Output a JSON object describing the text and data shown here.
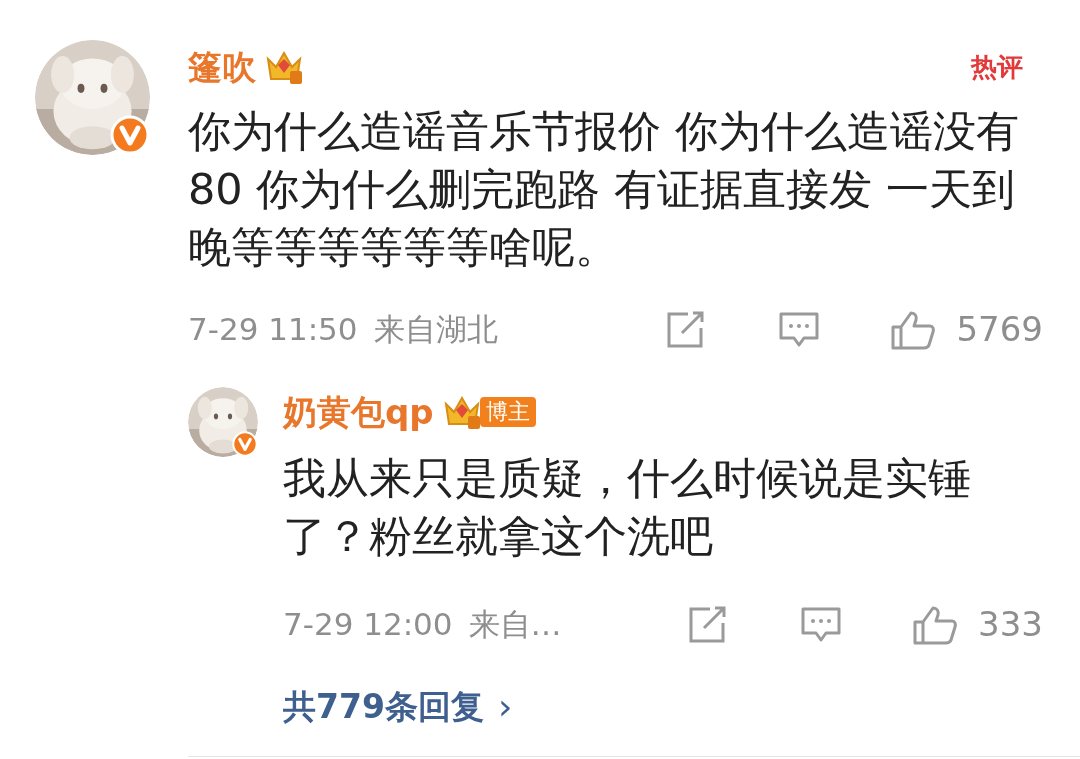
{
  "comment": {
    "author": "篷吹",
    "badge": "热评",
    "text": "你为什么造谣音乐节报价 你为什么造谣没有80 你为什么删完跑路 有证据直接发 一天到晚等等等等等等啥呢。",
    "time": "7-29 11:50",
    "location": "来自湖北",
    "likes": "5769",
    "reply": {
      "author": "奶黄包qp",
      "author_tag": "博主",
      "text": "我从来只是质疑，什么时候说是实锤了？粉丝就拿这个洗吧",
      "time": "7-29 12:00",
      "location": "来自…",
      "likes": "333"
    },
    "more_replies": "共779条回复",
    "more_arrow": "›"
  }
}
